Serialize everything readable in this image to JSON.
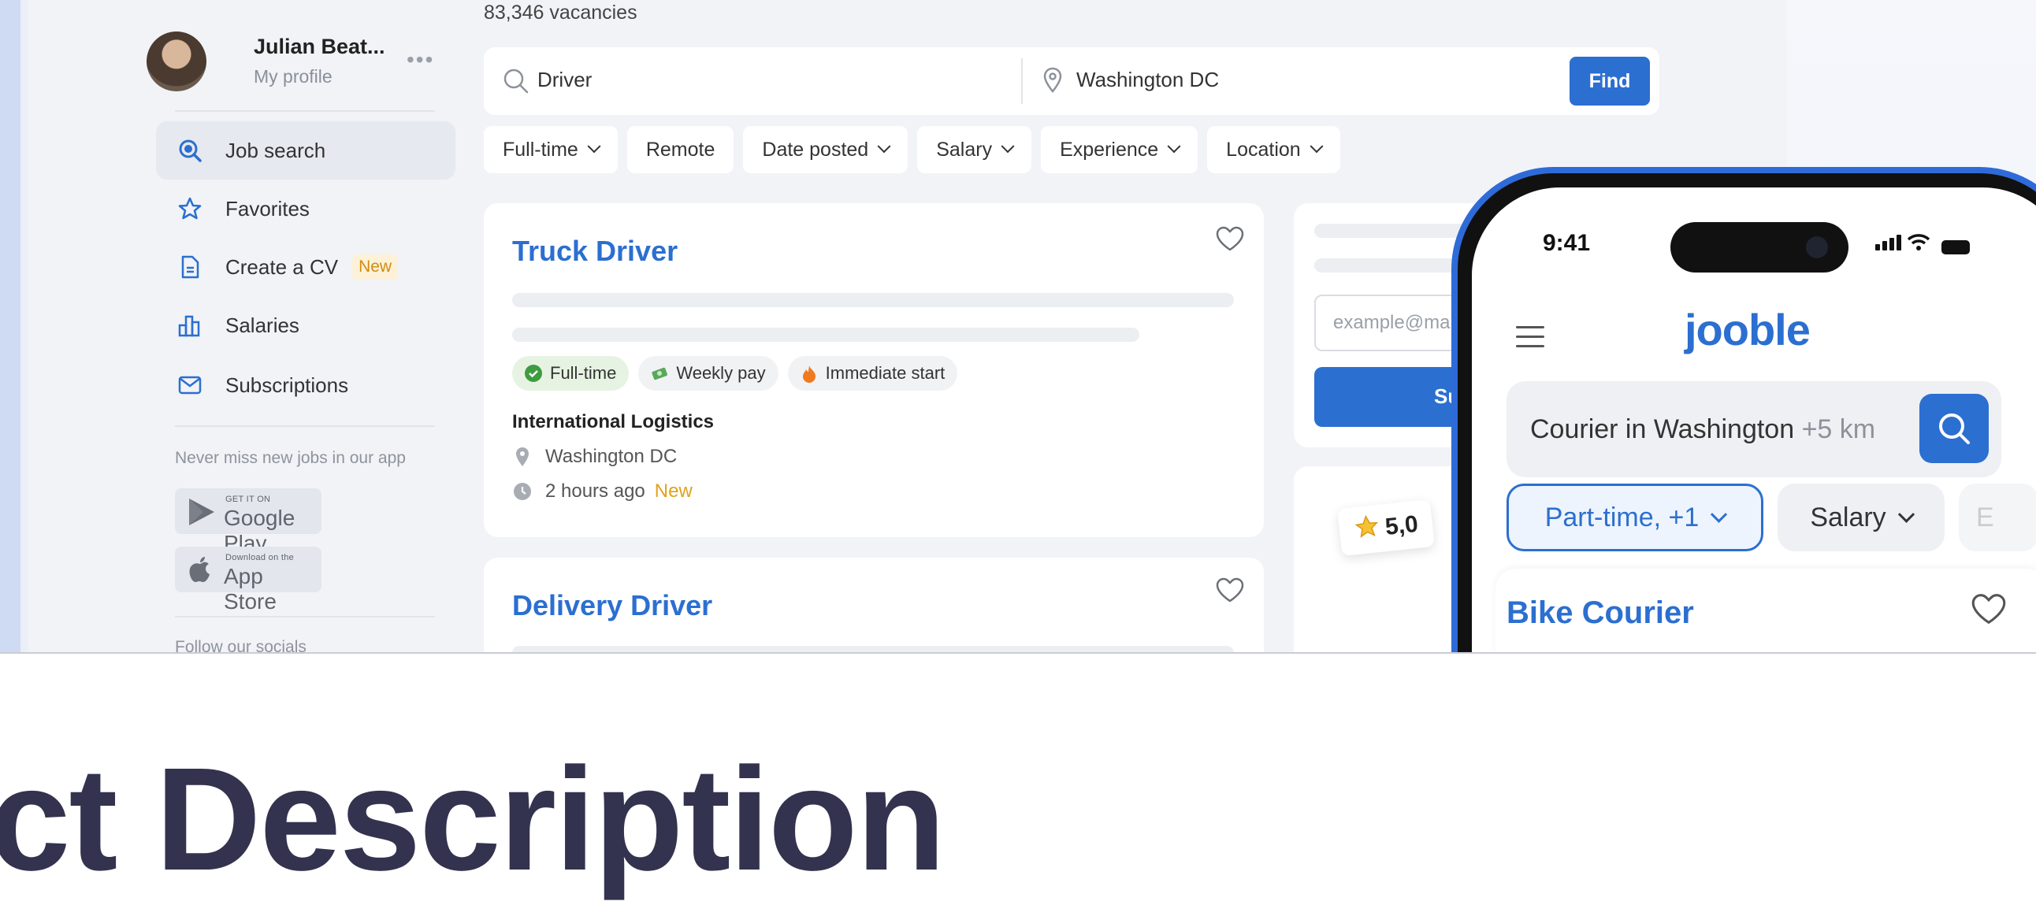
{
  "sidebar": {
    "user_name": "Julian Beat...",
    "user_sub": "My profile",
    "more": "•••",
    "items": [
      {
        "label": "Job search",
        "icon": "search-icon",
        "active": true
      },
      {
        "label": "Favorites",
        "icon": "star-icon"
      },
      {
        "label": "Create a CV",
        "icon": "document-icon",
        "badge": "New"
      },
      {
        "label": "Salaries",
        "icon": "bar-chart-icon"
      },
      {
        "label": "Subscriptions",
        "icon": "mail-icon"
      }
    ],
    "app_note": "Never miss new jobs in our app",
    "google_play": {
      "small": "GET IT ON",
      "large": "Google Play"
    },
    "app_store": {
      "small": "Download on the",
      "large": "App Store"
    },
    "follow": "Follow our socials"
  },
  "main": {
    "vacancies": "83,346 vacancies",
    "search": {
      "query": "Driver",
      "location": "Washington DC",
      "button": "Find"
    },
    "filters": [
      "Full-time",
      "Remote",
      "Date posted",
      "Salary",
      "Experience",
      "Location"
    ],
    "jobs": [
      {
        "title": "Truck Driver",
        "tags": [
          "Full-time",
          "Weekly pay",
          "Immediate start"
        ],
        "company": "International Logistics",
        "location": "Washington DC",
        "posted": "2 hours ago",
        "posted_badge": "New"
      },
      {
        "title": "Delivery Driver"
      }
    ],
    "subscribe": {
      "email_placeholder": "example@ma",
      "button": "Su"
    },
    "rating": "5,0"
  },
  "phone": {
    "time": "9:41",
    "logo": "jooble",
    "search_text": "Courier in Washington",
    "search_radius": "+5 km",
    "chips": [
      "Part-time, +1",
      "Salary",
      "E"
    ],
    "card_title": "Bike Courier"
  },
  "headline": "ct Description",
  "colors": {
    "accent": "#2b6fd0",
    "badge": "#d08c12",
    "headline": "#33334f"
  }
}
